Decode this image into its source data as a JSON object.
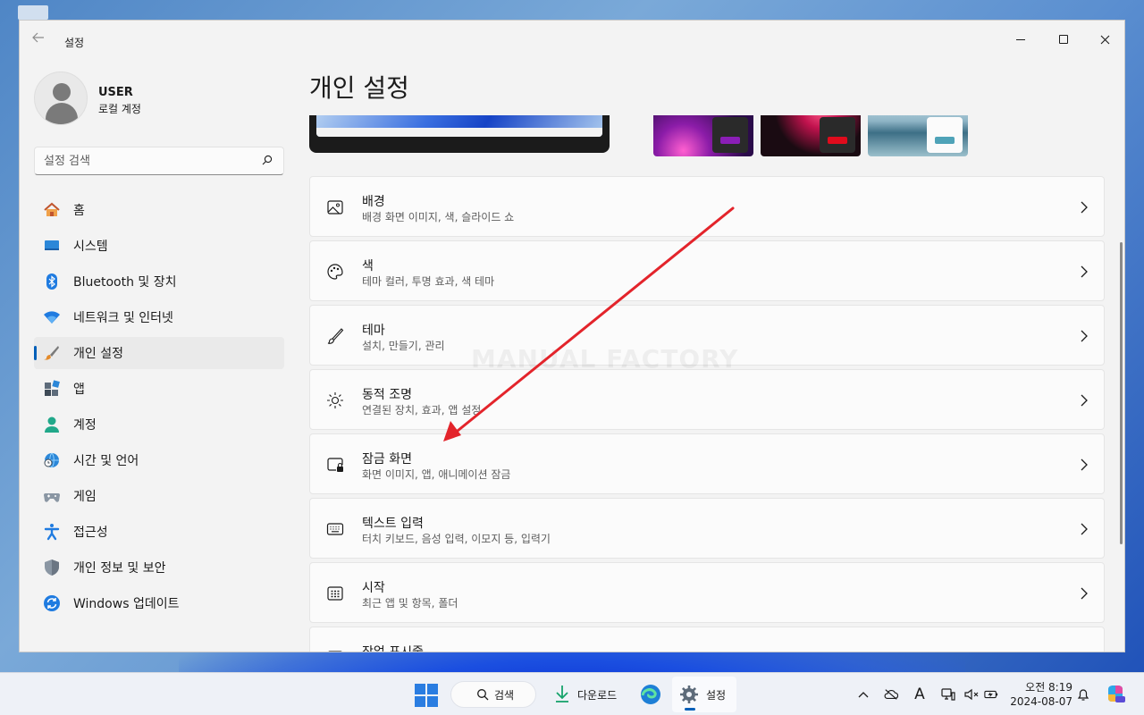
{
  "window": {
    "app_title": "설정"
  },
  "user": {
    "name": "USER",
    "account_type": "로컬 계정"
  },
  "search": {
    "placeholder": "설정 검색"
  },
  "sidebar": {
    "items": [
      {
        "label": "홈",
        "icon": "home-icon"
      },
      {
        "label": "시스템",
        "icon": "system-icon"
      },
      {
        "label": "Bluetooth 및 장치",
        "icon": "bluetooth-icon"
      },
      {
        "label": "네트워크 및 인터넷",
        "icon": "wifi-icon"
      },
      {
        "label": "개인 설정",
        "icon": "brush-icon",
        "active": true
      },
      {
        "label": "앱",
        "icon": "apps-icon"
      },
      {
        "label": "계정",
        "icon": "account-icon"
      },
      {
        "label": "시간 및 언어",
        "icon": "globe-clock-icon"
      },
      {
        "label": "게임",
        "icon": "gamepad-icon"
      },
      {
        "label": "접근성",
        "icon": "accessibility-icon"
      },
      {
        "label": "개인 정보 및 보안",
        "icon": "shield-icon"
      },
      {
        "label": "Windows 업데이트",
        "icon": "update-icon"
      }
    ]
  },
  "main": {
    "title": "개인 설정",
    "cards": [
      {
        "title": "배경",
        "subtitle": "배경 화면 이미지, 색, 슬라이드 쇼",
        "icon": "image-icon"
      },
      {
        "title": "색",
        "subtitle": "테마 컬러, 투명 효과, 색 테마",
        "icon": "palette-icon"
      },
      {
        "title": "테마",
        "subtitle": "설치, 만들기, 관리",
        "icon": "brush-icon"
      },
      {
        "title": "동적 조명",
        "subtitle": "연결된 장치, 효과, 앱 설정",
        "icon": "lighting-icon"
      },
      {
        "title": "잠금 화면",
        "subtitle": "화면 이미지, 앱, 애니메이션 잠금",
        "icon": "lock-screen-icon"
      },
      {
        "title": "텍스트 입력",
        "subtitle": "터치 키보드, 음성 입력, 이모지 등, 입력기",
        "icon": "keyboard-icon"
      },
      {
        "title": "시작",
        "subtitle": "최근 앱 및 항목, 폴더",
        "icon": "start-menu-icon"
      },
      {
        "title": "작업 표시줄",
        "subtitle": "",
        "icon": "taskbar-icon"
      }
    ],
    "watermark": "MANUAL FACTORY"
  },
  "taskbar": {
    "search_label": "검색",
    "download_label": "다운로드",
    "settings_label": "설정",
    "ime_label": "A",
    "time": "오전 8:19",
    "date": "2024-08-07"
  },
  "colors": {
    "accent": "#005fb8",
    "annotation_arrow": "#e3242b"
  }
}
